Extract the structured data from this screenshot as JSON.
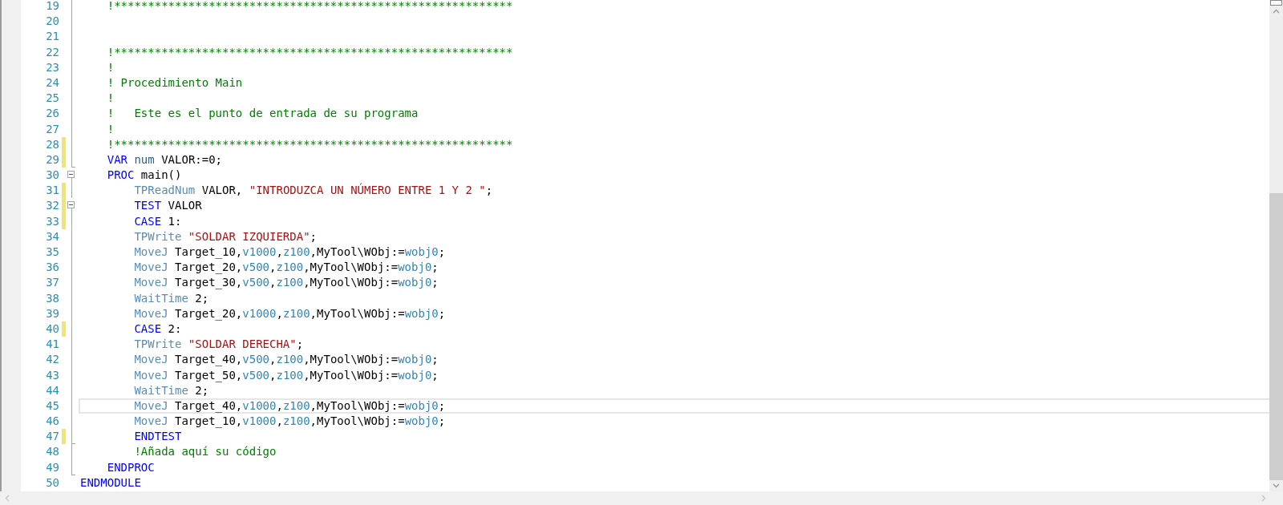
{
  "editor": {
    "lines": [
      {
        "number": "19",
        "changed": false,
        "current": false,
        "kind": "body",
        "tokens": [
          {
            "kind": "comment",
            "text": "    !***********************************************************"
          }
        ]
      },
      {
        "number": "20",
        "changed": false,
        "current": false,
        "kind": "body"
      },
      {
        "number": "21",
        "changed": false,
        "current": false,
        "kind": "body"
      },
      {
        "number": "22",
        "changed": false,
        "current": false,
        "kind": "body",
        "tokens": [
          {
            "kind": "comment",
            "text": "    !***********************************************************"
          }
        ]
      },
      {
        "number": "23",
        "changed": false,
        "current": false,
        "kind": "body",
        "tokens": [
          {
            "kind": "comment",
            "text": "    !"
          }
        ]
      },
      {
        "number": "24",
        "changed": false,
        "current": false,
        "kind": "body",
        "tokens": [
          {
            "kind": "comment",
            "text": "    ! Procedimiento Main"
          }
        ]
      },
      {
        "number": "25",
        "changed": false,
        "current": false,
        "kind": "body",
        "tokens": [
          {
            "kind": "comment",
            "text": "    !"
          }
        ]
      },
      {
        "number": "26",
        "changed": false,
        "current": false,
        "kind": "body",
        "tokens": [
          {
            "kind": "comment",
            "text": "    !   Este es el punto de entrada de su programa"
          }
        ]
      },
      {
        "number": "27",
        "changed": false,
        "current": false,
        "kind": "body",
        "tokens": [
          {
            "kind": "comment",
            "text": "    !"
          }
        ]
      },
      {
        "number": "28",
        "changed": true,
        "current": false,
        "kind": "body",
        "tokens": [
          {
            "kind": "comment",
            "text": "    !***********************************************************"
          }
        ]
      },
      {
        "number": "29",
        "changed": true,
        "current": false,
        "kind": "end",
        "tokens": [
          {
            "kind": "keyword",
            "text": "    VAR"
          },
          {
            "kind": "type",
            "text": " num"
          },
          {
            "kind": "plain",
            "text": " VALOR:=0;"
          }
        ]
      },
      {
        "number": "30",
        "changed": false,
        "current": false,
        "kind": "start",
        "tokens": [
          {
            "kind": "keyword",
            "text": "    PROC"
          },
          {
            "kind": "plain",
            "text": " main()"
          }
        ]
      },
      {
        "number": "31",
        "changed": true,
        "current": false,
        "kind": "body",
        "tokens": [
          {
            "kind": "instruction",
            "text": "        TPReadNum"
          },
          {
            "kind": "plain",
            "text": " VALOR, "
          },
          {
            "kind": "string",
            "text": "\"INTRODUZCA UN NÚMERO ENTRE 1 Y 2 \""
          },
          {
            "kind": "plain",
            "text": ";"
          }
        ]
      },
      {
        "number": "32",
        "changed": true,
        "current": false,
        "kind": "start",
        "tokens": [
          {
            "kind": "keyword",
            "text": "        TEST"
          },
          {
            "kind": "plain",
            "text": " VALOR"
          }
        ]
      },
      {
        "number": "33",
        "changed": true,
        "current": false,
        "kind": "body",
        "tokens": [
          {
            "kind": "keyword",
            "text": "        CASE"
          },
          {
            "kind": "plain",
            "text": " 1:"
          }
        ]
      },
      {
        "number": "34",
        "changed": false,
        "current": false,
        "kind": "body",
        "tokens": [
          {
            "kind": "instruction",
            "text": "        TPWrite "
          },
          {
            "kind": "string",
            "text": "\"SOLDAR IZQUIERDA\""
          },
          {
            "kind": "plain",
            "text": ";"
          }
        ]
      },
      {
        "number": "35",
        "changed": false,
        "current": false,
        "kind": "body",
        "tokens": [
          {
            "kind": "instruction",
            "text": "        MoveJ"
          },
          {
            "kind": "plain",
            "text": " Target_10,"
          },
          {
            "kind": "data",
            "text": "v1000"
          },
          {
            "kind": "plain",
            "text": ","
          },
          {
            "kind": "data",
            "text": "z100"
          },
          {
            "kind": "plain",
            "text": ",MyTool\\WObj:="
          },
          {
            "kind": "data",
            "text": "wobj0"
          },
          {
            "kind": "plain",
            "text": ";"
          }
        ]
      },
      {
        "number": "36",
        "changed": false,
        "current": false,
        "kind": "body",
        "tokens": [
          {
            "kind": "instruction",
            "text": "        MoveJ"
          },
          {
            "kind": "plain",
            "text": " Target_20,"
          },
          {
            "kind": "data",
            "text": "v500"
          },
          {
            "kind": "plain",
            "text": ","
          },
          {
            "kind": "data",
            "text": "z100"
          },
          {
            "kind": "plain",
            "text": ",MyTool\\WObj:="
          },
          {
            "kind": "data",
            "text": "wobj0"
          },
          {
            "kind": "plain",
            "text": ";"
          }
        ]
      },
      {
        "number": "37",
        "changed": false,
        "current": false,
        "kind": "body",
        "tokens": [
          {
            "kind": "instruction",
            "text": "        MoveJ"
          },
          {
            "kind": "plain",
            "text": " Target_30,"
          },
          {
            "kind": "data",
            "text": "v500"
          },
          {
            "kind": "plain",
            "text": ","
          },
          {
            "kind": "data",
            "text": "z100"
          },
          {
            "kind": "plain",
            "text": ",MyTool\\WObj:="
          },
          {
            "kind": "data",
            "text": "wobj0"
          },
          {
            "kind": "plain",
            "text": ";"
          }
        ]
      },
      {
        "number": "38",
        "changed": false,
        "current": false,
        "kind": "body",
        "tokens": [
          {
            "kind": "instruction",
            "text": "        WaitTime"
          },
          {
            "kind": "plain",
            "text": " 2;"
          }
        ]
      },
      {
        "number": "39",
        "changed": false,
        "current": false,
        "kind": "body",
        "tokens": [
          {
            "kind": "instruction",
            "text": "        MoveJ"
          },
          {
            "kind": "plain",
            "text": " Target_20,"
          },
          {
            "kind": "data",
            "text": "v1000"
          },
          {
            "kind": "plain",
            "text": ","
          },
          {
            "kind": "data",
            "text": "z100"
          },
          {
            "kind": "plain",
            "text": ",MyTool\\WObj:="
          },
          {
            "kind": "data",
            "text": "wobj0"
          },
          {
            "kind": "plain",
            "text": ";"
          }
        ]
      },
      {
        "number": "40",
        "changed": true,
        "current": false,
        "kind": "body",
        "tokens": [
          {
            "kind": "keyword",
            "text": "        CASE"
          },
          {
            "kind": "plain",
            "text": " 2:"
          }
        ]
      },
      {
        "number": "41",
        "changed": false,
        "current": false,
        "kind": "body",
        "tokens": [
          {
            "kind": "instruction",
            "text": "        TPWrite "
          },
          {
            "kind": "string",
            "text": "\"SOLDAR DERECHA\""
          },
          {
            "kind": "plain",
            "text": ";"
          }
        ]
      },
      {
        "number": "42",
        "changed": false,
        "current": false,
        "kind": "body",
        "tokens": [
          {
            "kind": "instruction",
            "text": "        MoveJ"
          },
          {
            "kind": "plain",
            "text": " Target_40,"
          },
          {
            "kind": "data",
            "text": "v500"
          },
          {
            "kind": "plain",
            "text": ","
          },
          {
            "kind": "data",
            "text": "z100"
          },
          {
            "kind": "plain",
            "text": ",MyTool\\WObj:="
          },
          {
            "kind": "data",
            "text": "wobj0"
          },
          {
            "kind": "plain",
            "text": ";"
          }
        ]
      },
      {
        "number": "43",
        "changed": false,
        "current": false,
        "kind": "body",
        "tokens": [
          {
            "kind": "instruction",
            "text": "        MoveJ"
          },
          {
            "kind": "plain",
            "text": " Target_50,"
          },
          {
            "kind": "data",
            "text": "v500"
          },
          {
            "kind": "plain",
            "text": ","
          },
          {
            "kind": "data",
            "text": "z100"
          },
          {
            "kind": "plain",
            "text": ",MyTool\\WObj:="
          },
          {
            "kind": "data",
            "text": "wobj0"
          },
          {
            "kind": "plain",
            "text": ";"
          }
        ]
      },
      {
        "number": "44",
        "changed": false,
        "current": false,
        "kind": "body",
        "tokens": [
          {
            "kind": "instruction",
            "text": "        WaitTime"
          },
          {
            "kind": "plain",
            "text": " 2;"
          }
        ]
      },
      {
        "number": "45",
        "changed": false,
        "current": true,
        "kind": "body",
        "tokens": [
          {
            "kind": "instruction",
            "text": "        MoveJ"
          },
          {
            "kind": "plain",
            "text": " Target_40,"
          },
          {
            "kind": "data",
            "text": "v1000"
          },
          {
            "kind": "plain",
            "text": ","
          },
          {
            "kind": "data",
            "text": "z100"
          },
          {
            "kind": "plain",
            "text": ",MyTool\\WObj:="
          },
          {
            "kind": "data",
            "text": "wobj0"
          },
          {
            "kind": "plain",
            "text": ";"
          }
        ]
      },
      {
        "number": "46",
        "changed": false,
        "current": false,
        "kind": "body",
        "tokens": [
          {
            "kind": "instruction",
            "text": "        MoveJ"
          },
          {
            "kind": "plain",
            "text": " Target_10,"
          },
          {
            "kind": "data",
            "text": "v1000"
          },
          {
            "kind": "plain",
            "text": ","
          },
          {
            "kind": "data",
            "text": "z100"
          },
          {
            "kind": "plain",
            "text": ",MyTool\\WObj:="
          },
          {
            "kind": "data",
            "text": "wobj0"
          },
          {
            "kind": "plain",
            "text": ";"
          }
        ]
      },
      {
        "number": "47",
        "changed": true,
        "current": false,
        "kind": "end",
        "tokens": [
          {
            "kind": "keyword",
            "text": "        ENDTEST"
          }
        ]
      },
      {
        "number": "48",
        "changed": false,
        "current": false,
        "kind": "body",
        "tokens": [
          {
            "kind": "comment",
            "text": "        !Añada aquí su código"
          }
        ]
      },
      {
        "number": "49",
        "changed": false,
        "current": false,
        "kind": "end",
        "tokens": [
          {
            "kind": "keyword",
            "text": "    ENDPROC"
          }
        ]
      },
      {
        "number": "50",
        "changed": false,
        "current": false,
        "kind": "outside",
        "tokens": [
          {
            "kind": "keyword",
            "text": "ENDMODULE"
          }
        ]
      }
    ]
  }
}
